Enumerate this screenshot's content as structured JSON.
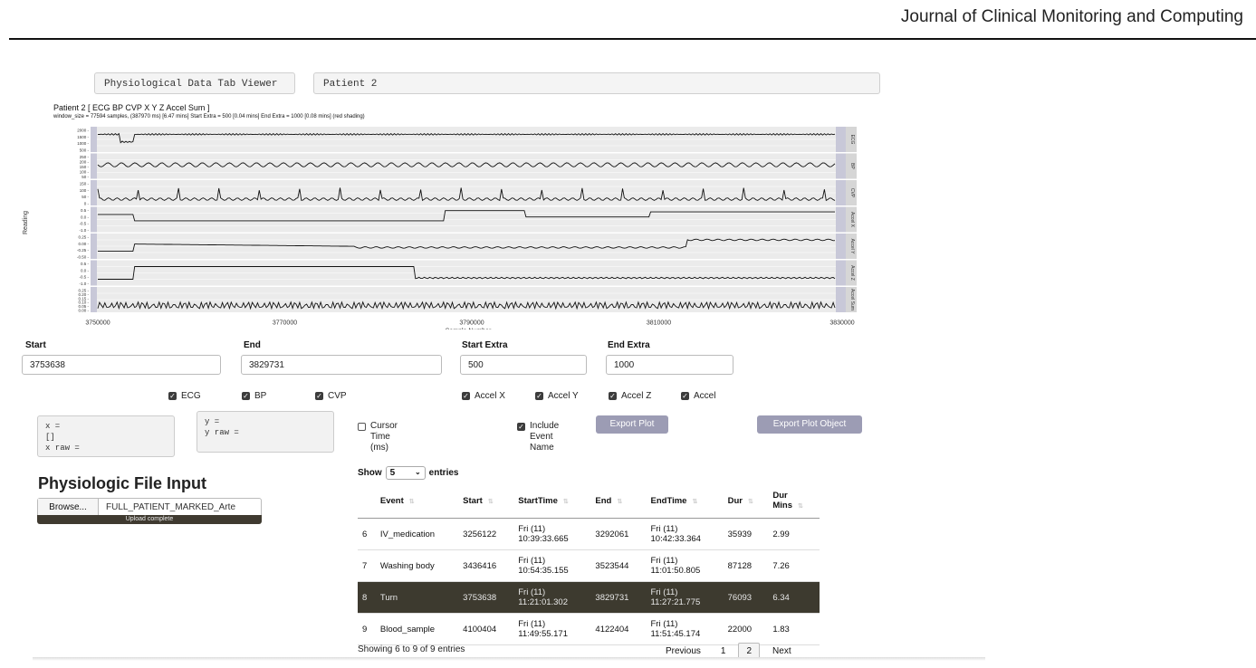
{
  "journal": "Journal of Clinical Monitoring and Computing",
  "viewer_title": "Physiological Data Tab Viewer",
  "patient_tab": "Patient 2",
  "plot": {
    "title": "Patient 2 [ ECG BP CVP X Y Z Accel Sum ]",
    "subtitle": "window_size = 77594 samples, (387970 ms) [6.47 mins] Start Extra = 500 [0.04 mins]  End Extra = 1000 [0.08 mins] (red shading)",
    "ylabel": "Reading",
    "xlabel": "Sample Number",
    "xticks": [
      "3750000",
      "3770000",
      "3790000",
      "3810000",
      "3830000"
    ],
    "panels": [
      {
        "label": "ECG",
        "ticks": [
          "2000 -",
          "1500 -",
          "1000 -",
          "500 -"
        ]
      },
      {
        "label": "BP",
        "ticks": [
          "250 -",
          "200 -",
          "150 -",
          "100 -",
          "50 -"
        ]
      },
      {
        "label": "CVP",
        "ticks": [
          "150 -",
          "100 -",
          "50 -",
          "0 -"
        ]
      },
      {
        "label": "Accel X",
        "ticks": [
          "0.5 -",
          "0.0 -",
          "-0.5 -",
          "-1.0 -"
        ]
      },
      {
        "label": "Accel Y",
        "ticks": [
          "0.25 -",
          "0.00 -",
          "-0.25 -",
          "-0.50 -"
        ]
      },
      {
        "label": "Accel Z",
        "ticks": [
          "0.5 -",
          "0.0 -",
          "-0.5 -",
          "-1.0 -"
        ]
      },
      {
        "label": "Accel Sum",
        "ticks": [
          "0.25 -",
          "0.20 -",
          "0.15 -",
          "0.10 -",
          "0.05 -",
          "0.00 -"
        ]
      }
    ]
  },
  "fields": {
    "start_label": "Start",
    "start_value": "3753638",
    "end_label": "End",
    "end_value": "3829731",
    "start_extra_label": "Start Extra",
    "start_extra_value": "500",
    "end_extra_label": "End Extra",
    "end_extra_value": "1000"
  },
  "checkboxes": [
    "ECG",
    "BP",
    "CVP",
    "Accel X",
    "Accel Y",
    "Accel Z",
    "Accel"
  ],
  "coords": {
    "x_box": "x =\n[]\nx raw =",
    "y_box": "y =\ny raw ="
  },
  "options": {
    "cursor": "Cursor\nTime\n(ms)",
    "include": "Include\nEvent\nName"
  },
  "buttons": {
    "export_plot": "Export Plot",
    "export_plot_object": "Export Plot Object"
  },
  "file_input": {
    "heading": "Physiologic File Input",
    "browse": "Browse...",
    "filename": "FULL_PATIENT_MARKED_Arte",
    "status": "Upload complete"
  },
  "table": {
    "show": "Show",
    "length": "5",
    "entries": "entries",
    "headers": [
      "Event",
      "Start",
      "StartTime",
      "End",
      "EndTime",
      "Dur",
      "Dur\nMins"
    ],
    "rows": [
      [
        "6",
        "IV_medication",
        "3256122",
        "Fri (11)\n10:39:33.665",
        "3292061",
        "Fri (11)\n10:42:33.364",
        "35939",
        "2.99"
      ],
      [
        "7",
        "Washing body",
        "3436416",
        "Fri (11)\n10:54:35.155",
        "3523544",
        "Fri (11)\n11:01:50.805",
        "87128",
        "7.26"
      ],
      [
        "8",
        "Turn",
        "3753638",
        "Fri (11)\n11:21:01.302",
        "3829731",
        "Fri (11)\n11:27:21.775",
        "76093",
        "6.34"
      ],
      [
        "9",
        "Blood_sample",
        "4100404",
        "Fri (11)\n11:49:55.171",
        "4122404",
        "Fri (11)\n11:51:45.174",
        "22000",
        "1.83"
      ]
    ],
    "selected_row": 2,
    "info": "Showing 6 to 9 of 9 entries",
    "previous": "Previous",
    "page1": "1",
    "page2": "2",
    "next": "Next"
  }
}
